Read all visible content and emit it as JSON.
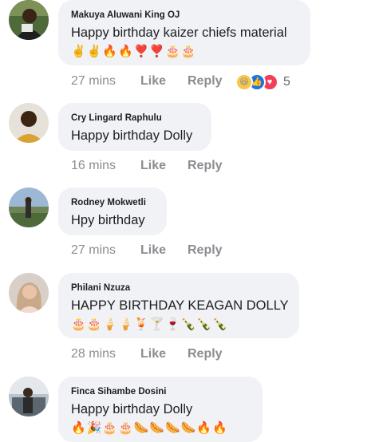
{
  "comments": [
    {
      "author": "Makuya Aluwani King OJ",
      "text": "Happy birthday kaizer chiefs material",
      "emojis": "✌️✌️🔥🔥❣️❣️🎂🎂",
      "time": "27 mins",
      "like": "Like",
      "reply": "Reply",
      "reactions": {
        "icons": [
          "haha-icon",
          "like-icon",
          "love-icon"
        ],
        "count": "5"
      }
    },
    {
      "author": "Cry Lingard Raphulu",
      "text": "Happy birthday Dolly",
      "time": "16 mins",
      "like": "Like",
      "reply": "Reply"
    },
    {
      "author": "Rodney Mokwetli",
      "text": "Hpy birthday",
      "time": "27 mins",
      "like": "Like",
      "reply": "Reply"
    },
    {
      "author": "Philani Nzuza",
      "text": "HAPPY BIRTHDAY KEAGAN DOLLY",
      "emojis": "🎂🎂🍦🍦🍹🍸🍷🍾🍾🍾",
      "time": "28 mins",
      "like": "Like",
      "reply": "Reply"
    },
    {
      "author": "Finca Sihambe Dosini",
      "text": "Happy birthday Dolly",
      "emojis": "🔥🎉🎂🎂🌭🌭🌭🌭🔥🔥"
    }
  ],
  "colors": {
    "bubble": "#f0f2f5",
    "meta_text": "#8a8d91",
    "like_reaction": "#1b74e4",
    "love_reaction": "#f33e58",
    "haha_reaction": "#f7c64a"
  }
}
